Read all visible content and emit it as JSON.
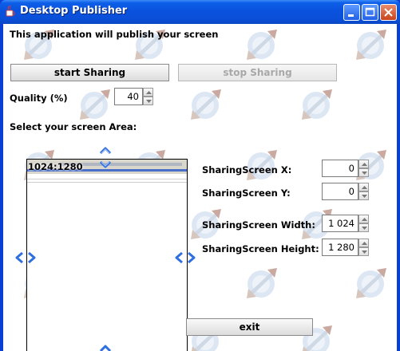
{
  "window": {
    "title": "Desktop Publisher"
  },
  "intro_text": "This application will publish your screen",
  "buttons": {
    "start": "start Sharing",
    "stop": "stop Sharing",
    "exit": "exit"
  },
  "quality": {
    "label": "Quality (%)",
    "value": "40"
  },
  "area_label": "Select your screen Area:",
  "preview": {
    "resolution": "1024:1280"
  },
  "fields": [
    {
      "label": "SharingScreen X:",
      "value": "0"
    },
    {
      "label": "SharingScreen Y:",
      "value": "0"
    },
    {
      "label": "SharingScreen Width:",
      "value": "1 024"
    },
    {
      "label": "SharingScreen Height:",
      "value": "1 280"
    }
  ],
  "colors": {
    "title_bar": "#0a52de",
    "arrow_blue": "#2f6fe0",
    "logo_blue": "#c8d8ee"
  },
  "icons": {
    "app": "java-cup-icon",
    "minimize": "minimize-icon",
    "maximize": "maximize-icon",
    "close": "close-icon",
    "resize_arrows": "double-chevron-icon"
  }
}
